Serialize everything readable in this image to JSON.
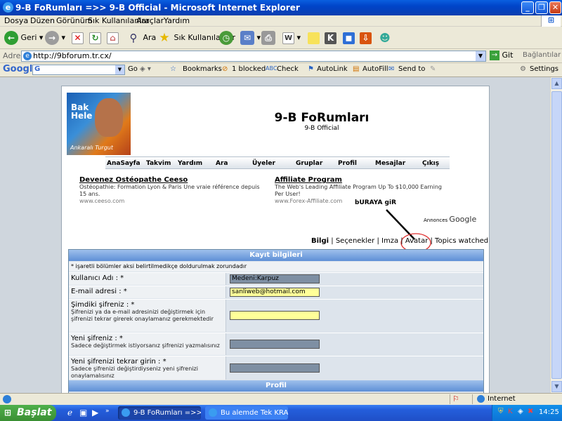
{
  "window": {
    "title": "9-B FoRumları =>> 9-B Official - Microsoft Internet Explorer"
  },
  "menu": [
    "Dosya",
    "Düzen",
    "Görünüm",
    "Sık Kullanılanlar",
    "Araçlar",
    "Yardım"
  ],
  "toolbar": {
    "back_label": "Geri",
    "search_label": "Ara",
    "favorites_label": "Sık Kullanılanlar"
  },
  "address": {
    "label": "Adres",
    "url": "http://9bforum.tr.cx/",
    "go_label": "Git",
    "links_label": "Bağlantılar"
  },
  "google_bar": {
    "logo": "Google",
    "go_label": "Go",
    "bookmarks": "Bookmarks",
    "blocked": "1 blocked",
    "check": "Check",
    "autolink": "AutoLink",
    "autofill": "AutoFill",
    "sendto": "Send to",
    "settings": "Settings"
  },
  "forum": {
    "logo_text_top": "Bak Hele",
    "logo_text_bottom": "Ankaralı Turgut",
    "title": "9-B FoRumları",
    "subtitle": "9-B Official",
    "nav": [
      "AnaSayfa",
      "Takvim",
      "Yardım",
      "Ara",
      "Üyeler",
      "Gruplar",
      "Profil",
      "Mesajlar",
      "Çıkış"
    ],
    "ads": [
      {
        "title": "Devenez Ostéopathe Ceeso",
        "body": "Ostéopathie: Formation Lyon & Paris Une vraie référence depuis 15 ans.",
        "url": "www.ceeso.com"
      },
      {
        "title": "Affiliate Program",
        "body": "The Web's Leading Affiliate Program Up To $10,000 Earning Per User!",
        "url": "www.Forex-Affiliate.com"
      }
    ],
    "annotation": "bURAYA giR",
    "annonces": "Annonces",
    "annonces_brand": "Google",
    "profile_tabs": [
      "Bilgi",
      "Seçenekler",
      "Imza",
      "Avatar",
      "Topics watched"
    ],
    "form_header": "Kayıt bilgileri",
    "form_note": "* işaretli bölümler aksi belirtilmedikçe doldurulmak zorundadır",
    "fields": [
      {
        "label": "Kullanıcı Adı : *",
        "help": "",
        "value": "Medeni:Karpuz"
      },
      {
        "label": "E-mail adresi : *",
        "help": "",
        "value": "sanliweb@hotmail.com"
      },
      {
        "label": "Şimdiki şifreniz : *",
        "help": "Şifrenizi ya da e-mail adresinizi değiştirmek için şifrenizi tekrar girerek onaylamanız gerekmektedir",
        "value": ""
      },
      {
        "label": "Yeni şifreniz : *",
        "help": "Sadece değiştirmek istiyorsanız şifrenizi yazmalısınız",
        "value": ""
      },
      {
        "label": "Yeni şifrenizi tekrar girin : *",
        "help": "Sadece şifrenizi değiştirdiyseniz yeni şifrenizi onaylamalısınız",
        "value": ""
      }
    ],
    "next_section": "Profil"
  },
  "status": {
    "zone": "Internet"
  },
  "taskbar": {
    "start": "Başlat",
    "tasks": [
      "9-B FoRumları =>> 9...",
      "Bu alemde Tek KRAL ..."
    ],
    "clock": "14:25"
  },
  "colors": {
    "accent_blue": "#0a5fe0",
    "form_header": "#6d93c8",
    "highlight_input": "#ffff99",
    "grey_input": "#7e8fa3",
    "annotation_red": "#e03030"
  }
}
